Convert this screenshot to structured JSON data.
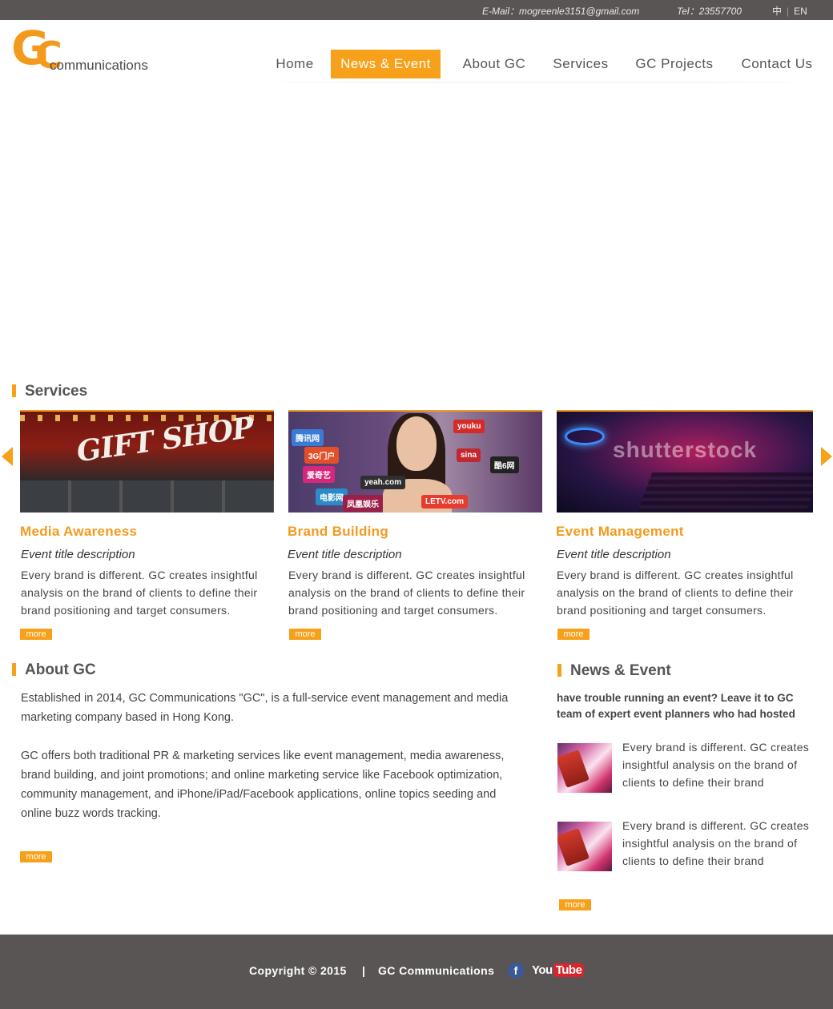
{
  "topbar": {
    "email": "E-Mail：mogreenle3151@gmail.com",
    "tel": "Tel：23557700",
    "lang_zh": "中",
    "lang_en": "EN"
  },
  "logo": {
    "letter_g": "G",
    "letter_c": "C",
    "word": "communications"
  },
  "nav": {
    "items": [
      {
        "label": "Home"
      },
      {
        "label": "News & Event"
      },
      {
        "label": "About GC"
      },
      {
        "label": "Services"
      },
      {
        "label": "GC Projects"
      },
      {
        "label": "Contact Us"
      }
    ],
    "active_index": 1
  },
  "services": {
    "title": "Services",
    "cards": [
      {
        "title": "Media Awareness",
        "subtitle": "Event title description",
        "text": "Every brand is different.  GC creates insightful analysis on the brand of clients to define their brand positioning and target consumers.",
        "more": "more",
        "image_sign": "GIFT SHOP"
      },
      {
        "title": "Brand Building",
        "subtitle": "Event title description",
        "text": "Every brand is different.  GC creates insightful analysis on the brand of clients to define their brand positioning and target consumers.",
        "more": "more",
        "image_mics": [
          "腾讯网",
          "3G门户",
          "youku",
          "爱奇艺",
          "sina",
          "酷6网",
          "yeah.com",
          "电影网",
          "LETV.com",
          "凤凰娱乐"
        ]
      },
      {
        "title": "Event Management",
        "subtitle": "Event title description",
        "text": "Every brand is different.  GC creates insightful analysis on the brand of clients to define their brand positioning and target consumers.",
        "more": "more",
        "image_watermark": "shutterstock"
      }
    ]
  },
  "about": {
    "title": "About GC",
    "p1": "Established in 2014, GC Communications \"GC\", is a full-service event management and media marketing company based in Hong Kong.",
    "p2": "GC offers both traditional PR & marketing services like event management, media awareness, brand building, and joint promotions; and online marketing service like Facebook optimization, community management, and iPhone/iPad/Facebook applications, online topics seeding and online buzz words tracking.",
    "more": "more"
  },
  "news": {
    "title": "News & Event",
    "intro": "have trouble running an event?  Leave it to GC team of expert event planners who had hosted",
    "items": [
      {
        "text": "Every brand is different.  GC creates insightful analysis on the brand of clients to define their brand"
      },
      {
        "text": "Every brand is different.  GC creates insightful analysis on the brand of clients to define their brand"
      }
    ],
    "more": "more"
  },
  "footer": {
    "copyright": "Copyright © 2015",
    "separator": "|",
    "company": "GC Communications",
    "facebook_glyph": "f",
    "youtube_you": "You",
    "youtube_tube": "Tube"
  },
  "colors": {
    "accent": "#f7a11a",
    "topbar_bg": "#5a5555",
    "footer_bg": "#5a5555",
    "title_orange": "#f39a1d"
  }
}
